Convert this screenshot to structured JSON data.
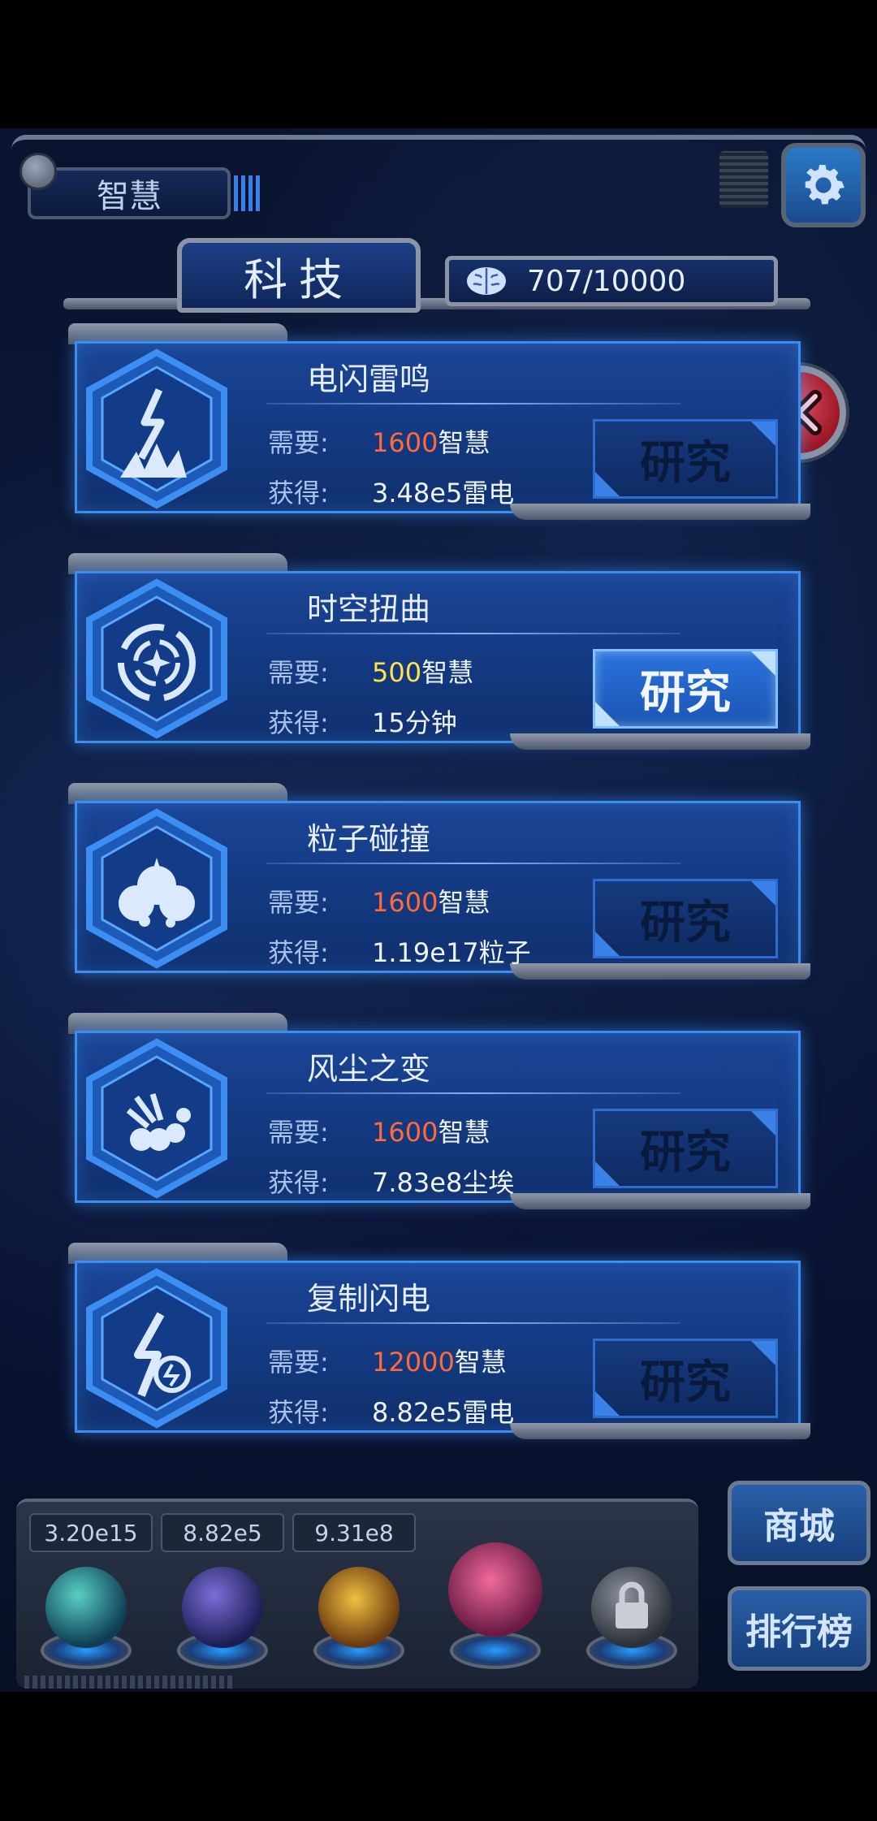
{
  "top": {
    "wisdom_tab_label": "智慧"
  },
  "header": {
    "title": "科技",
    "counter": "707/10000"
  },
  "tech_items": [
    {
      "title": "电闪雷鸣",
      "need_label": "需要:",
      "need_amount": "1600",
      "need_unit": "智慧",
      "need_color": "red",
      "gain_label": "获得:",
      "gain_value": "3.48e5雷电",
      "button_label": "研究",
      "active": false,
      "icon": "lightning-burst-icon"
    },
    {
      "title": "时空扭曲",
      "need_label": "需要:",
      "need_amount": "500",
      "need_unit": "智慧",
      "need_color": "yellow",
      "gain_label": "获得:",
      "gain_value": "15分钟",
      "button_label": "研究",
      "active": true,
      "icon": "vortex-icon"
    },
    {
      "title": "粒子碰撞",
      "need_label": "需要:",
      "need_amount": "1600",
      "need_unit": "智慧",
      "need_color": "red",
      "gain_label": "获得:",
      "gain_value": "1.19e17粒子",
      "button_label": "研究",
      "active": false,
      "icon": "particle-collision-icon"
    },
    {
      "title": "风尘之变",
      "need_label": "需要:",
      "need_amount": "1600",
      "need_unit": "智慧",
      "need_color": "red",
      "gain_label": "获得:",
      "gain_value": "7.83e8尘埃",
      "button_label": "研究",
      "active": false,
      "icon": "dust-explosion-icon"
    },
    {
      "title": "复制闪电",
      "need_label": "需要:",
      "need_amount": "12000",
      "need_unit": "智慧",
      "need_color": "red",
      "gain_label": "获得:",
      "gain_value": "8.82e5雷电",
      "button_label": "研究",
      "active": false,
      "icon": "copy-lightning-icon"
    }
  ],
  "resources": {
    "labels": [
      "3.20e15",
      "8.82e5",
      "9.31e8"
    ],
    "orbs": [
      "particle-orb",
      "lightning-orb",
      "dust-orb",
      "wisdom-orb",
      "locked-orb"
    ]
  },
  "side_buttons": {
    "top": "商城",
    "bottom": "排行榜"
  },
  "colors": {
    "red": "#ff6a3a",
    "yellow": "#ffe34a",
    "accent": "#3d8cf0"
  }
}
